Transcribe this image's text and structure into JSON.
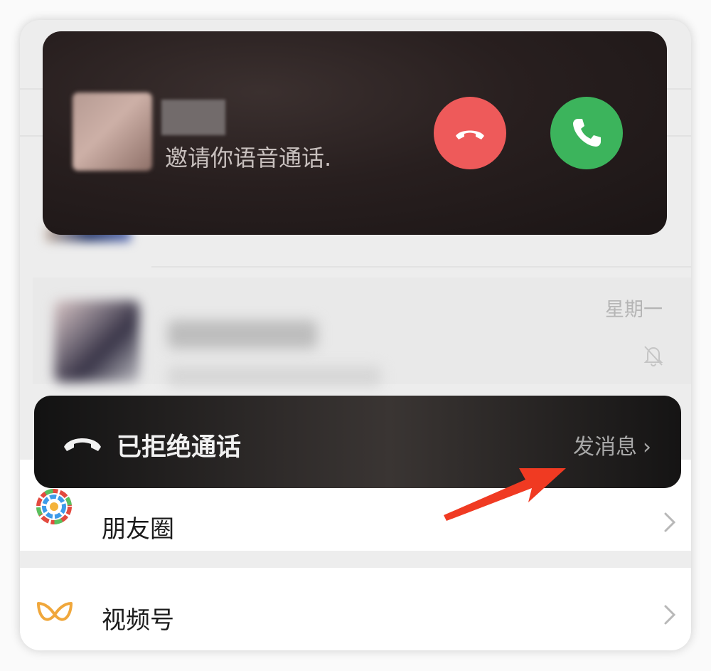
{
  "incoming_call": {
    "subtitle": "邀请你语音通话.",
    "decline_color": "#ee5a5a",
    "answer_color": "#3cb45c"
  },
  "chat_list": {
    "item_time": "星期一"
  },
  "call_status": {
    "text": "已拒绝通话",
    "action": "发消息"
  },
  "menu": {
    "moments": "朋友圈",
    "channels": "视频号"
  },
  "annotation": {
    "arrow_color": "#f03a22"
  }
}
